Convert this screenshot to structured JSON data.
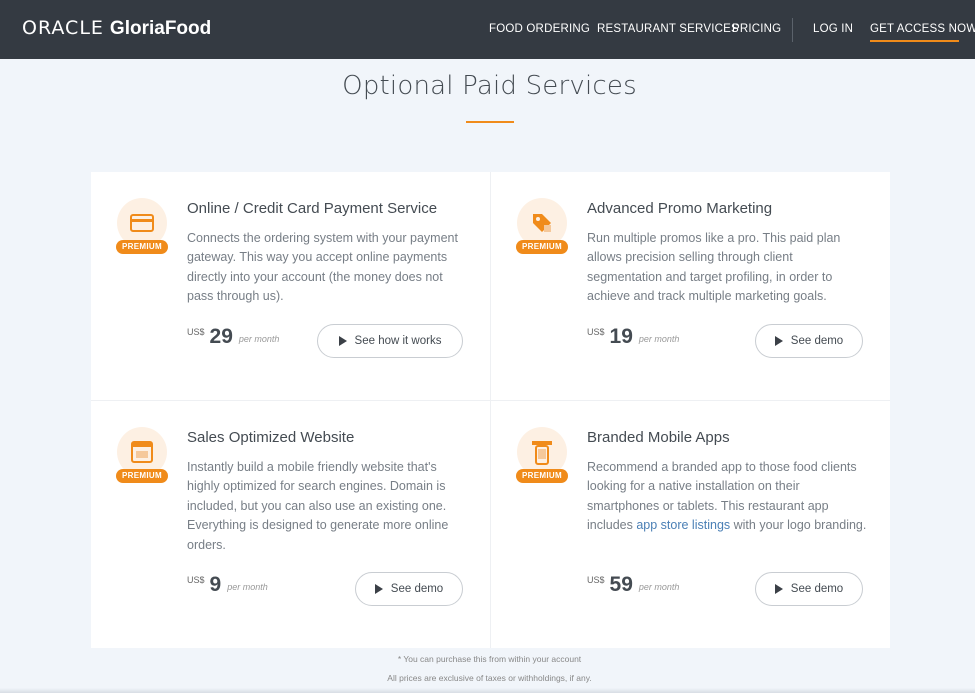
{
  "header": {
    "logo_oracle": "ORACLE",
    "logo_brand": "GloriaFood",
    "nav": [
      "FOOD ORDERING",
      "RESTAURANT SERVICES",
      "PRICING",
      "LOG IN",
      "GET ACCESS NOW"
    ]
  },
  "page": {
    "title": "Optional Paid Services"
  },
  "cards": [
    {
      "icon": "credit-card-icon",
      "badge": "PREMIUM",
      "title": "Online / Credit Card Payment Service",
      "desc": "Connects the ordering system with your payment gateway. This way you accept online payments directly into your account (the money does not pass through us).",
      "currency": "US$",
      "amount": "29",
      "period": "per month",
      "button": "See how it works"
    },
    {
      "icon": "promo-tag-icon",
      "badge": "PREMIUM",
      "title": "Advanced Promo Marketing",
      "desc": "Run multiple promos like a pro. This paid plan allows precision selling through client segmentation and target profiling, in order to achieve and track multiple marketing goals.",
      "currency": "US$",
      "amount": "19",
      "period": "per month",
      "button": "See demo"
    },
    {
      "icon": "website-icon",
      "badge": "PREMIUM",
      "title": "Sales Optimized Website",
      "desc": "Instantly build a mobile friendly website that's highly optimized for search engines. Domain is included, but you can also use an existing one. Everything is designed to generate more online orders.",
      "currency": "US$",
      "amount": "9",
      "period": "per month",
      "button": "See demo"
    },
    {
      "icon": "mobile-app-icon",
      "badge": "PREMIUM",
      "title": "Branded Mobile Apps",
      "desc_before": "Recommend a branded app to those food clients looking for a native installation on their smartphones or tablets. This restaurant app includes ",
      "desc_link": "app store listings",
      "desc_after": " with your logo branding.",
      "currency": "US$",
      "amount": "59",
      "period": "per month",
      "button": "See demo"
    }
  ],
  "footer": {
    "note1": "* You can purchase this from within your account",
    "note2": "All prices are exclusive of taxes or withholdings, if any."
  },
  "colors": {
    "accent": "#f08b1a",
    "header_bg": "#343a42",
    "link": "#4a7fb5"
  }
}
